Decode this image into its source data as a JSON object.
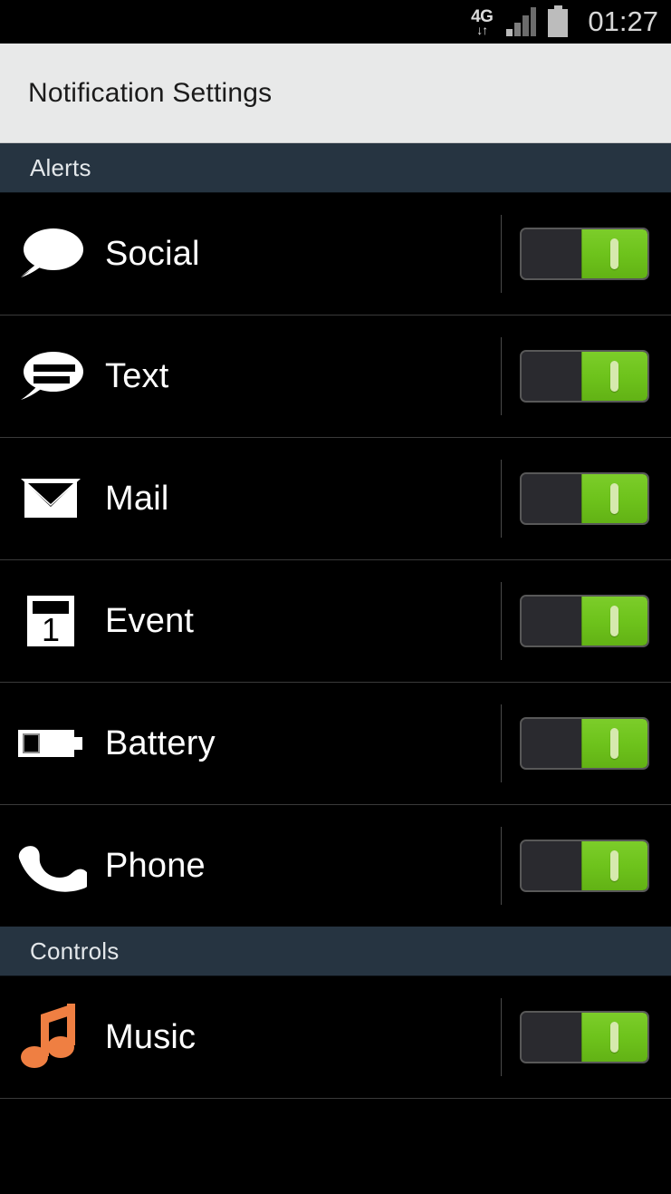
{
  "status_bar": {
    "network_label": "4G",
    "network_arrows": "↓↑",
    "clock": "01:27",
    "signal_icon": "signal-bars-icon",
    "battery_icon": "battery-icon",
    "signal_bars_total": 4,
    "signal_bars_active": 2
  },
  "header": {
    "title": "Notification Settings"
  },
  "sections": [
    {
      "id": "alerts",
      "title": "Alerts",
      "rows": [
        {
          "id": "social",
          "label": "Social",
          "icon": "speech-bubble-icon",
          "icon_color": "#ffffff",
          "toggle_on": true
        },
        {
          "id": "text",
          "label": "Text",
          "icon": "speech-bubble-lines-icon",
          "icon_color": "#ffffff",
          "toggle_on": true
        },
        {
          "id": "mail",
          "label": "Mail",
          "icon": "envelope-icon",
          "icon_color": "#ffffff",
          "toggle_on": true
        },
        {
          "id": "event",
          "label": "Event",
          "icon": "calendar-icon",
          "icon_color": "#ffffff",
          "toggle_on": true
        },
        {
          "id": "battery",
          "label": "Battery",
          "icon": "battery-icon",
          "icon_color": "#ffffff",
          "toggle_on": true
        },
        {
          "id": "phone",
          "label": "Phone",
          "icon": "phone-handset-icon",
          "icon_color": "#ffffff",
          "toggle_on": true
        }
      ]
    },
    {
      "id": "controls",
      "title": "Controls",
      "rows": [
        {
          "id": "music",
          "label": "Music",
          "icon": "music-note-icon",
          "icon_color": "#ef7f42",
          "toggle_on": true
        }
      ]
    }
  ],
  "colors": {
    "background": "#000000",
    "title_bar": "#e8e9e9",
    "section_header": "#263441",
    "toggle_on_green": "#6ec31c",
    "toggle_track_off": "#2a2a2f",
    "divider": "#3a3a3a",
    "music_orange": "#ef7f42"
  }
}
